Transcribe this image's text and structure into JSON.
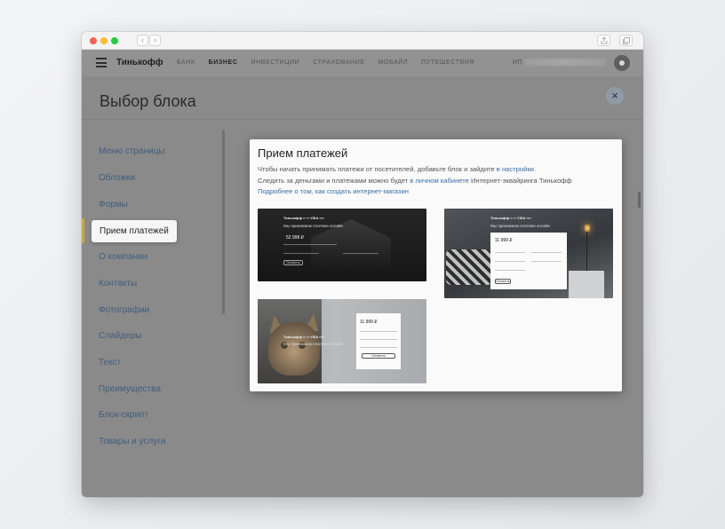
{
  "browser": {
    "back": "‹",
    "forward": "›"
  },
  "header": {
    "brand": "Тинькофф",
    "nav": [
      "БАНК",
      "БИЗНЕС",
      "ИНВЕСТИЦИИ",
      "СТРАХОВАНИЕ",
      "МОБАЙЛ",
      "ПУТЕШЕСТВИЯ"
    ],
    "active_nav": "БИЗНЕС",
    "account_prefix": "ИП"
  },
  "modal": {
    "title": "Выбор блока",
    "close": "×"
  },
  "sidebar": {
    "items": [
      {
        "label": "Меню страницы"
      },
      {
        "label": "Обложки"
      },
      {
        "label": "Формы"
      },
      {
        "label": "Прием платежей",
        "active": true
      },
      {
        "label": "О компании"
      },
      {
        "label": "Контакты"
      },
      {
        "label": "Фотографии"
      },
      {
        "label": "Слайдеры"
      },
      {
        "label": "Текст"
      },
      {
        "label": "Преимущества"
      },
      {
        "label": "Блок-скрипт"
      },
      {
        "label": "Товары и услуги"
      }
    ],
    "accent_color": "#c9a93a"
  },
  "panel": {
    "title": "Прием платежей",
    "desc_line1_text": "Чтобы начать принимать платежи от посетителей, добавьте блок и зайдите ",
    "desc_line1_link": "в настройки",
    "desc_line1_end": ".",
    "desc_line2_text": "Следить за деньгами и платежами можно будет ",
    "desc_line2_link": "в личном кабинете",
    "desc_line2_end": " Интернет-эквайринга Тинькофф",
    "desc_line3_link": "Подробнее о том, как создать интернет-магазин",
    "link_color": "#3a6fa6"
  },
  "thumbnails": {
    "logo": "Тинькофф ▪▪ ▪▪ VISA ▪▪▪▪",
    "headline": "Мы принимаем платежи онлайн",
    "amount_a": "52 999 ₽",
    "amount_b": "11 999 ₽",
    "button": "Оплатить"
  }
}
